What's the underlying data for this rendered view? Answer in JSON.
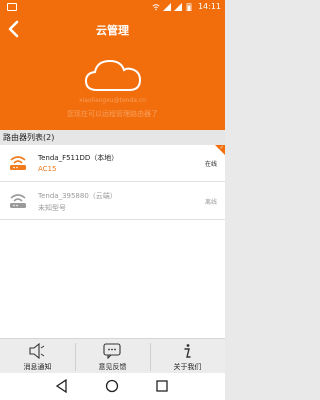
{
  "status_bar": {
    "time": "14:11"
  },
  "header": {
    "title": "云管理",
    "account": "xiaoliangxu@tenda.cn",
    "subtitle": "您现在可以远程管理路由器了"
  },
  "router_list": {
    "heading": "路由器列表(2)",
    "items": [
      {
        "name": "Tenda_F511DD（本地）",
        "model": "AC15",
        "status": "在线",
        "icon": "wifi-router-icon",
        "color": "#f07a1c"
      },
      {
        "name": "Tenda_395880（云端）",
        "model": "未知型号",
        "status": "离线",
        "icon": "wifi-router-icon",
        "color": "#9a9a9a"
      }
    ]
  },
  "tabbar": {
    "tabs": [
      {
        "label": "消息通知",
        "icon": "speaker-icon"
      },
      {
        "label": "意见反馈",
        "icon": "feedback-icon"
      },
      {
        "label": "关于我们",
        "icon": "info-icon"
      }
    ]
  },
  "colors": {
    "accent": "#f26d0c",
    "online_text": "#f07a1c",
    "offline_text": "#9a9a9a"
  }
}
